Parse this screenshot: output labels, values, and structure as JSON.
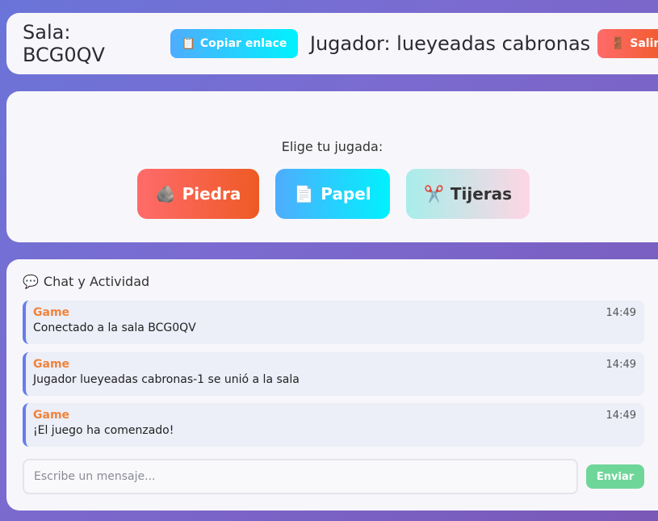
{
  "header": {
    "room_label": "Sala: BCG0QV",
    "copy_icon": "📋",
    "copy_label": "Copiar enlace",
    "player_label": "Jugador: lueyeadas cabronas",
    "exit_icon": "🚪",
    "exit_label": "Salir"
  },
  "game": {
    "prompt": "Elige tu jugada:",
    "choices": [
      {
        "icon": "🪨",
        "label": "Piedra"
      },
      {
        "icon": "📄",
        "label": "Papel"
      },
      {
        "icon": "✂️",
        "label": "Tijeras"
      }
    ]
  },
  "chat": {
    "icon": "💬",
    "title": "Chat y Actividad",
    "messages": [
      {
        "author": "Game",
        "time": "14:49",
        "text": "Conectado a la sala BCG0QV"
      },
      {
        "author": "Game",
        "time": "14:49",
        "text": "Jugador lueyeadas cabronas-1 se unió a la sala"
      },
      {
        "author": "Game",
        "time": "14:49",
        "text": "¡El juego ha comenzado!"
      }
    ],
    "input_placeholder": "Escribe un mensaje...",
    "send_label": "Enviar"
  },
  "colors": {
    "accent": "#667eea",
    "author": "#f0833a",
    "send": "#6fd69a"
  }
}
